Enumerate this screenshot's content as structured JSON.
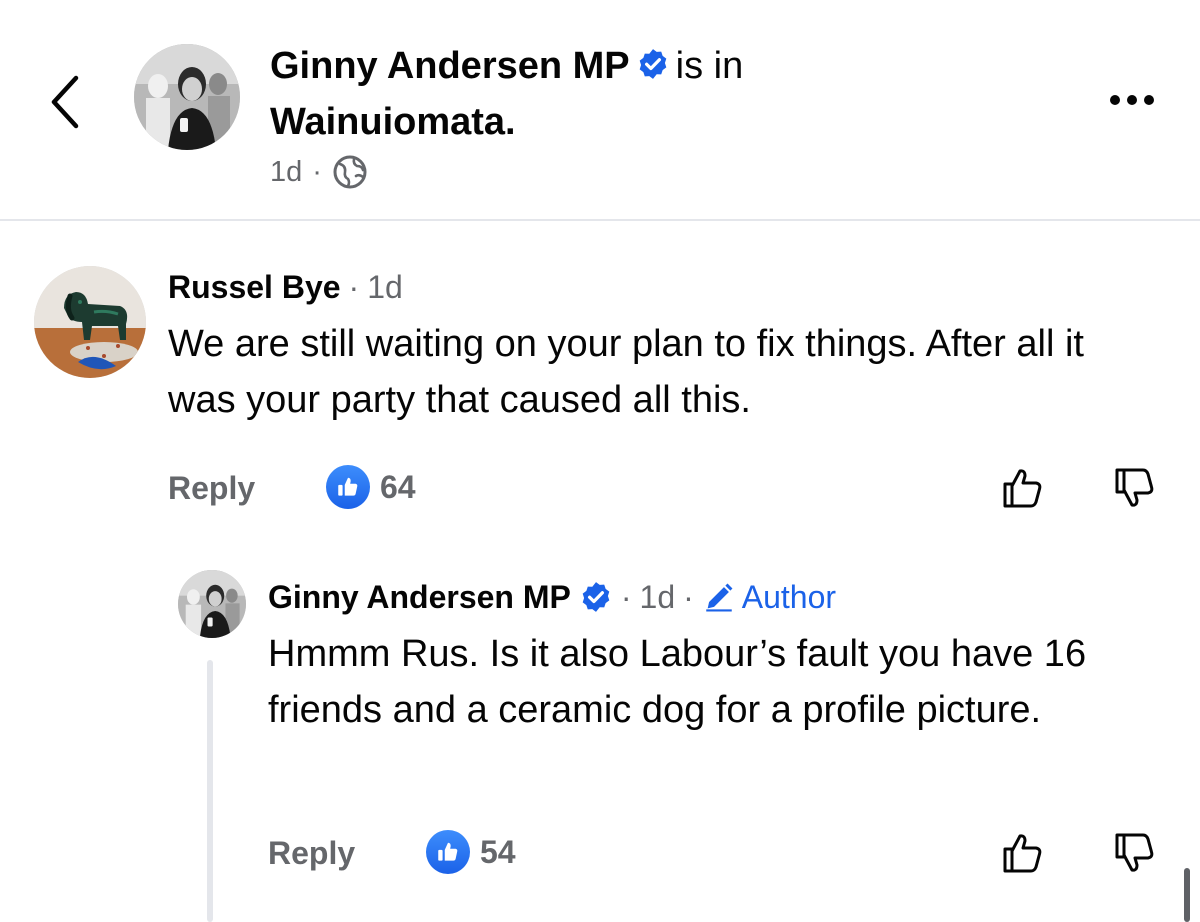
{
  "post_header": {
    "author_name": "Ginny Andersen MP",
    "is_in_text": "is in",
    "location": "Wainuiomata.",
    "timestamp": "1d",
    "separator": "·",
    "audience_icon": "globe-icon",
    "back_icon": "chevron-left-icon",
    "more_icon": "more-horizontal-icon"
  },
  "comments": [
    {
      "author": "Russel Bye",
      "separator": "·",
      "time": "1d",
      "text": "We are still waiting on your plan to fix things. After all it was your party that caused all this.",
      "reply_label": "Reply",
      "like_count": "64",
      "avatar_icon": "ceramic-dog-avatar"
    },
    {
      "author": "Ginny Andersen MP",
      "verified": true,
      "separator": "·",
      "time": "1d",
      "separator2": "·",
      "badge_label": "Author",
      "badge_icon": "pencil-icon",
      "text": "Hmmm Rus. Is it also Labour’s fault you have 16 friends and a ceramic dog for a profile picture.",
      "reply_label": "Reply",
      "like_count": "54"
    }
  ],
  "colors": {
    "accent": "#1b62e8",
    "muted_text": "#65676b",
    "divider": "#e4e6eb",
    "text": "#050505"
  }
}
